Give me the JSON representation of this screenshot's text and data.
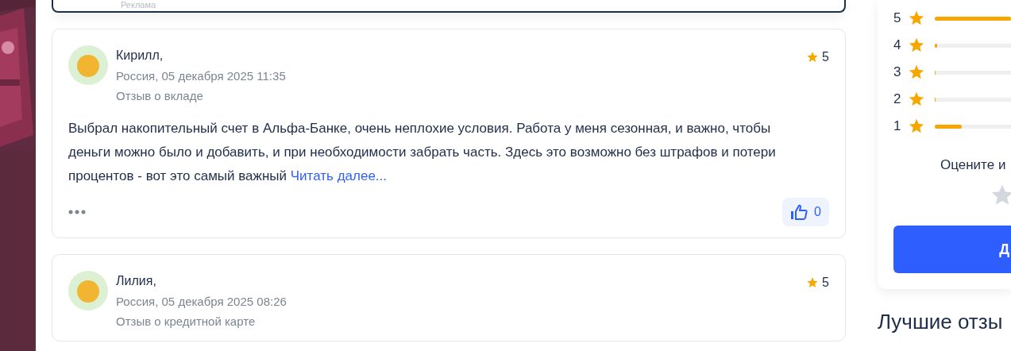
{
  "ad": {
    "label": "Реклама"
  },
  "reviews": [
    {
      "author": "Кирилл,",
      "meta": "Россия, 05 декабря 2025 11:35",
      "topic": "Отзыв о вкладе",
      "rating": "5",
      "text": "Выбрал накопительный счет в Альфа-Банке, очень неплохие условия. Работа у меня сезонная, и важно, чтобы деньги можно было и добавить, и при необходимости забрать часть. Здесь это возможно без штрафов и потери процентов - вот это самый важный",
      "more": "Читать далее...",
      "likes": "0"
    },
    {
      "author": "Лилия,",
      "meta": "Россия, 05 декабря 2025 08:26",
      "topic": "Отзыв о кредитной карте",
      "rating": "5"
    }
  ],
  "rating_summary": {
    "rows": [
      {
        "label": "5",
        "level": 1.0
      },
      {
        "label": "4",
        "level": 0.03
      },
      {
        "label": "3",
        "level": 0.01
      },
      {
        "label": "2",
        "level": 0.01
      },
      {
        "label": "1",
        "level": 0.35
      }
    ],
    "prompt": "Оцените и",
    "button": "Д"
  },
  "best_reviews_title": "Лучшие отзы"
}
